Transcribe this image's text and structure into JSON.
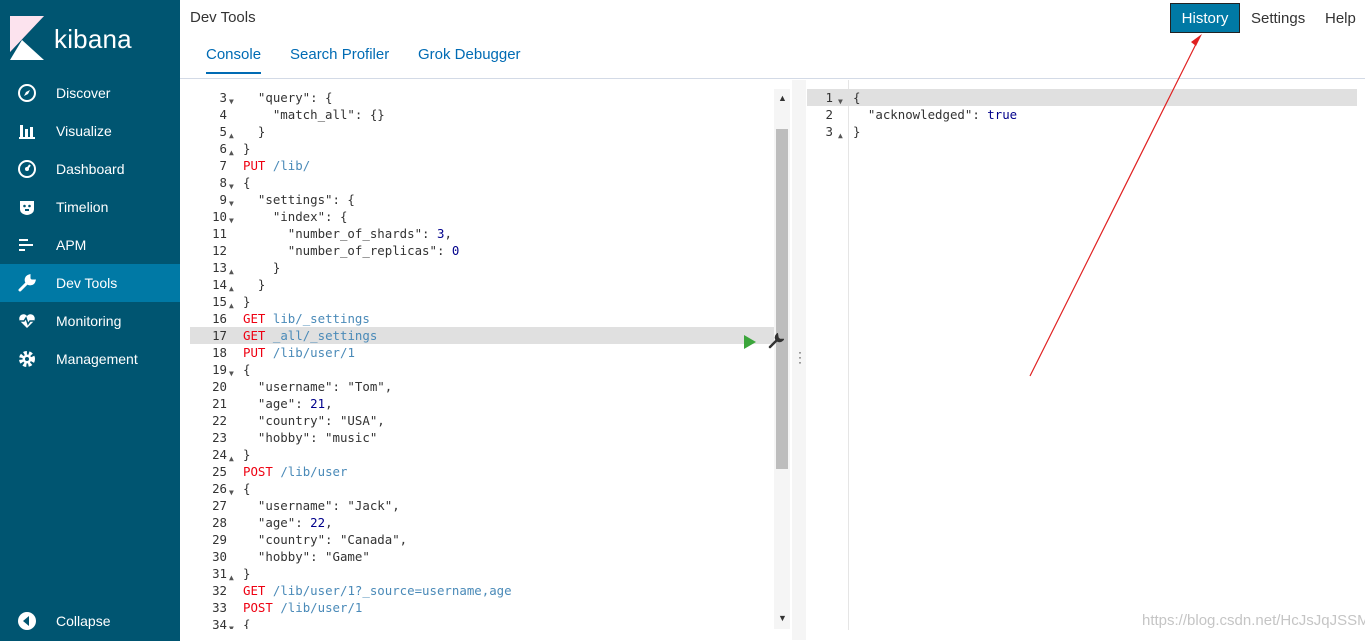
{
  "sidebar": {
    "brand": "kibana",
    "items": [
      {
        "label": "Discover",
        "icon": "compass-icon"
      },
      {
        "label": "Visualize",
        "icon": "bar-chart-icon"
      },
      {
        "label": "Dashboard",
        "icon": "gauge-icon"
      },
      {
        "label": "Timelion",
        "icon": "timelion-icon"
      },
      {
        "label": "APM",
        "icon": "apm-icon"
      },
      {
        "label": "Dev Tools",
        "icon": "wrench-icon",
        "active": true
      },
      {
        "label": "Monitoring",
        "icon": "heartbeat-icon"
      },
      {
        "label": "Management",
        "icon": "gear-icon"
      }
    ],
    "collapse_label": "Collapse"
  },
  "header": {
    "app_title": "Dev Tools",
    "tabs": [
      "Console",
      "Search Profiler",
      "Grok Debugger"
    ],
    "active_tab": "Console",
    "history_label": "History",
    "settings_label": "Settings",
    "help_label": "Help"
  },
  "editor": {
    "lines": [
      {
        "n": "3",
        "fold": "open",
        "text": "  \"query\": {"
      },
      {
        "n": "4",
        "fold": "",
        "text": "    \"match_all\": {}"
      },
      {
        "n": "5",
        "fold": "close",
        "text": "  }"
      },
      {
        "n": "6",
        "fold": "close",
        "text": "}"
      },
      {
        "n": "7",
        "fold": "",
        "method": "PUT",
        "url": "/lib/"
      },
      {
        "n": "8",
        "fold": "open",
        "text": "{"
      },
      {
        "n": "9",
        "fold": "open",
        "text": "  \"settings\": {"
      },
      {
        "n": "10",
        "fold": "open",
        "text": "    \"index\": {"
      },
      {
        "n": "11",
        "fold": "",
        "text": "      \"number_of_shards\": ",
        "num": "3",
        "tail": ","
      },
      {
        "n": "12",
        "fold": "",
        "text": "      \"number_of_replicas\": ",
        "num": "0"
      },
      {
        "n": "13",
        "fold": "close",
        "text": "    }"
      },
      {
        "n": "14",
        "fold": "close",
        "text": "  }"
      },
      {
        "n": "15",
        "fold": "close",
        "text": "}"
      },
      {
        "n": "16",
        "fold": "",
        "method": "GET",
        "url": "lib/_settings"
      },
      {
        "n": "17",
        "fold": "",
        "method": "GET",
        "url": "_all/_settings",
        "highlight": true
      },
      {
        "n": "18",
        "fold": "",
        "method": "PUT",
        "url": "/lib/user/1"
      },
      {
        "n": "19",
        "fold": "open",
        "text": "{"
      },
      {
        "n": "20",
        "fold": "",
        "text": "  \"username\": \"Tom\","
      },
      {
        "n": "21",
        "fold": "",
        "text": "  \"age\": ",
        "num": "21",
        "tail": ","
      },
      {
        "n": "22",
        "fold": "",
        "text": "  \"country\": \"USA\","
      },
      {
        "n": "23",
        "fold": "",
        "text": "  \"hobby\": \"music\""
      },
      {
        "n": "24",
        "fold": "close",
        "text": "}"
      },
      {
        "n": "25",
        "fold": "",
        "method": "POST",
        "url": "/lib/user"
      },
      {
        "n": "26",
        "fold": "open",
        "text": "{"
      },
      {
        "n": "27",
        "fold": "",
        "text": "  \"username\": \"Jack\","
      },
      {
        "n": "28",
        "fold": "",
        "text": "  \"age\": ",
        "num": "22",
        "tail": ","
      },
      {
        "n": "29",
        "fold": "",
        "text": "  \"country\": \"Canada\","
      },
      {
        "n": "30",
        "fold": "",
        "text": "  \"hobby\": \"Game\""
      },
      {
        "n": "31",
        "fold": "close",
        "text": "}"
      },
      {
        "n": "32",
        "fold": "",
        "method": "GET",
        "url": "/lib/user/1?_source=username,age"
      },
      {
        "n": "33",
        "fold": "",
        "method": "POST",
        "url": "/lib/user/1"
      },
      {
        "n": "34",
        "fold": "open",
        "text": "{"
      }
    ]
  },
  "output": {
    "lines": [
      {
        "n": "1",
        "fold": "open",
        "text": "{",
        "highlight": true
      },
      {
        "n": "2",
        "fold": "",
        "key": "  \"acknowledged\": ",
        "bool": "true"
      },
      {
        "n": "3",
        "fold": "close",
        "text": "}"
      }
    ]
  },
  "watermark": "https://blog.csdn.net/HcJsJqJSSM",
  "colors": {
    "sidebar": "#005571",
    "active": "#0079a5",
    "method": "#ee1111",
    "url": "#4a8ab8",
    "number": "#00008b"
  }
}
